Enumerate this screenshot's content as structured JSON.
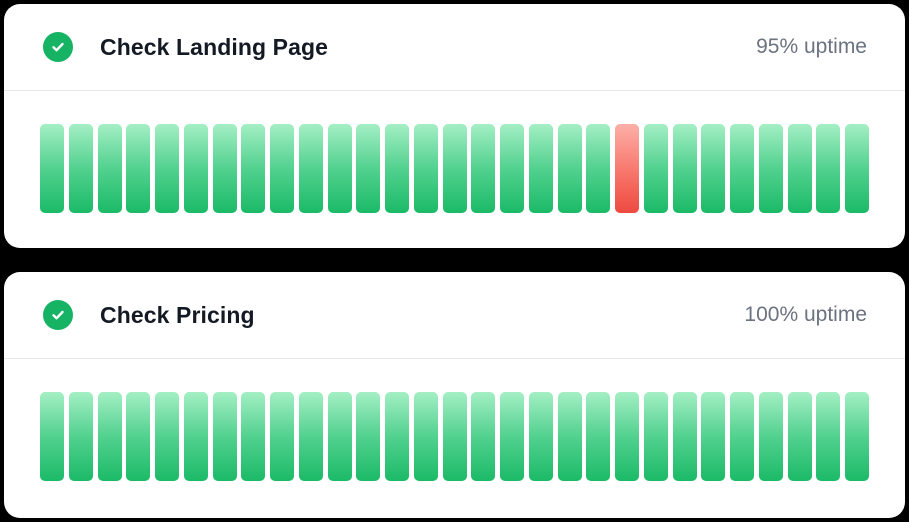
{
  "monitors": [
    {
      "title": "Check Landing Page",
      "uptime_label": "95% uptime",
      "status_icon": "check-circle-icon",
      "days": [
        "up",
        "up",
        "up",
        "up",
        "up",
        "up",
        "up",
        "up",
        "up",
        "up",
        "up",
        "up",
        "up",
        "up",
        "up",
        "up",
        "up",
        "up",
        "up",
        "up",
        "down",
        "up",
        "up",
        "up",
        "up",
        "up",
        "up",
        "up",
        "up"
      ]
    },
    {
      "title": "Check Pricing",
      "uptime_label": "100% uptime",
      "status_icon": "check-circle-icon",
      "days": [
        "up",
        "up",
        "up",
        "up",
        "up",
        "up",
        "up",
        "up",
        "up",
        "up",
        "up",
        "up",
        "up",
        "up",
        "up",
        "up",
        "up",
        "up",
        "up",
        "up",
        "up",
        "up",
        "up",
        "up",
        "up",
        "up",
        "up",
        "up",
        "up"
      ]
    }
  ],
  "colors": {
    "status_ok": "#16b364",
    "bar_up": "#1bba67",
    "bar_down": "#ee4a3f"
  }
}
